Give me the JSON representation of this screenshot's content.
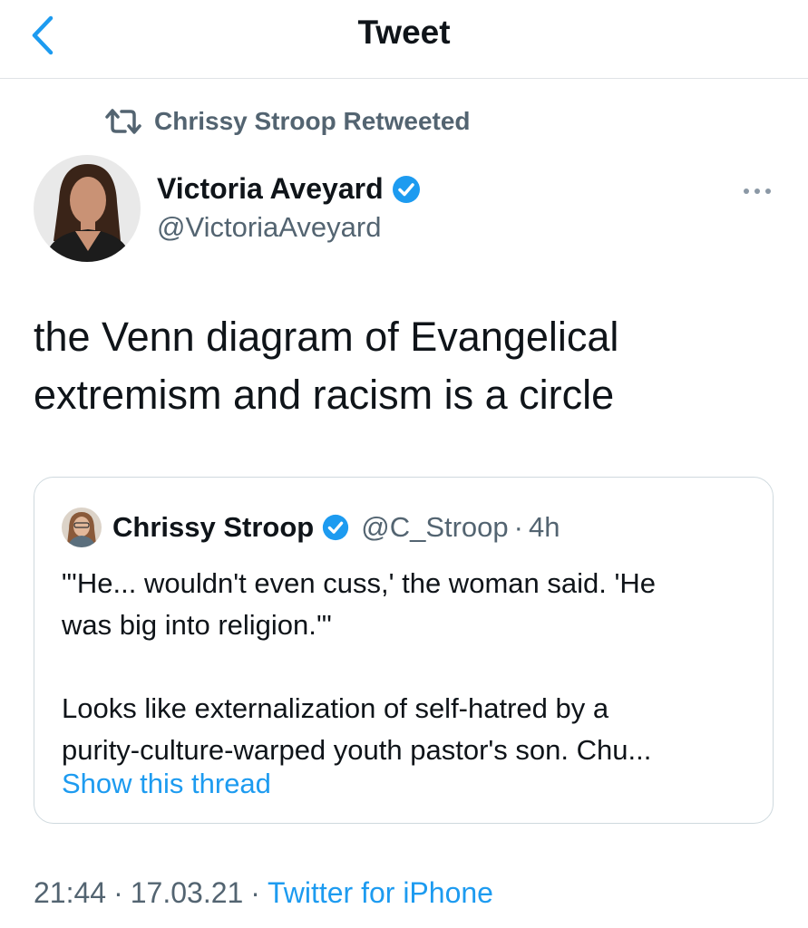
{
  "header": {
    "title": "Tweet",
    "back_icon": "chevron-left-icon"
  },
  "retweet_banner": {
    "text": "Chrissy Stroop Retweeted",
    "icon": "retweet-icon"
  },
  "author": {
    "name": "Victoria Aveyard",
    "handle": "@VictoriaAveyard",
    "verified": true
  },
  "tweet": {
    "line1": "the Venn diagram of Evangelical",
    "line2": "extremism and racism is a circle"
  },
  "quoted": {
    "name": "Chrissy Stroop",
    "handle": "@C_Stroop",
    "separator": "·",
    "time": "4h",
    "para1_line1": "\"'He... wouldn't even cuss,' the woman said. 'He",
    "para1_line2": "was big into religion.'\"",
    "para2_line1": "Looks like externalization of self-hatred by a",
    "para2_line2": "purity-culture-warped youth pastor's son. Chu...",
    "show_thread": "Show this thread"
  },
  "meta": {
    "time": "21:44",
    "date": "17.03.21",
    "source": "Twitter for iPhone",
    "separator": "·"
  },
  "colors": {
    "accent": "#1d9bf0",
    "secondary": "#536471",
    "border": "#cfd9de"
  }
}
